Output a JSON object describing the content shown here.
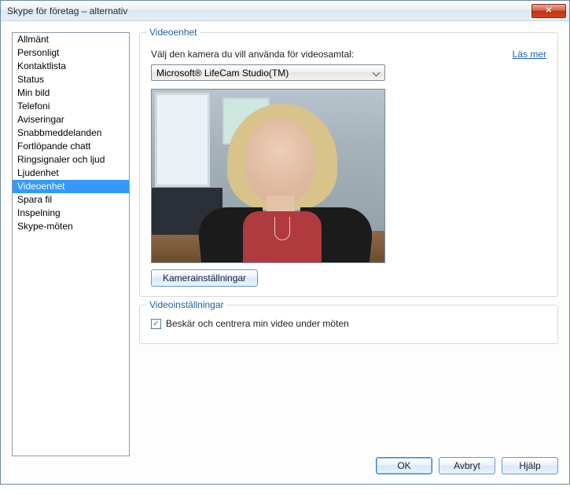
{
  "window": {
    "title": "Skype för företag – alternativ"
  },
  "sidebar": {
    "items": [
      {
        "label": "Allmänt"
      },
      {
        "label": "Personligt"
      },
      {
        "label": "Kontaktlista"
      },
      {
        "label": "Status"
      },
      {
        "label": "Min bild"
      },
      {
        "label": "Telefoni"
      },
      {
        "label": "Aviseringar"
      },
      {
        "label": "Snabbmeddelanden"
      },
      {
        "label": "Fortlöpande chatt"
      },
      {
        "label": "Ringsignaler och ljud"
      },
      {
        "label": "Ljudenhet"
      },
      {
        "label": "Videoenhet"
      },
      {
        "label": "Spara fil"
      },
      {
        "label": "Inspelning"
      },
      {
        "label": "Skype-möten"
      }
    ],
    "selected_index": 11
  },
  "device_group": {
    "title": "Videoenhet",
    "prompt": "Välj den kamera du vill använda för videosamtal:",
    "learn_more": "Läs mer",
    "selected_camera": "Microsoft® LifeCam Studio(TM)",
    "camera_settings_btn": "Kamerainställningar"
  },
  "settings_group": {
    "title": "Videoinställningar",
    "crop_checkbox": {
      "checked": true,
      "label": "Beskär och centrera min video under möten"
    }
  },
  "footer": {
    "ok": "OK",
    "cancel": "Avbryt",
    "help": "Hjälp"
  }
}
